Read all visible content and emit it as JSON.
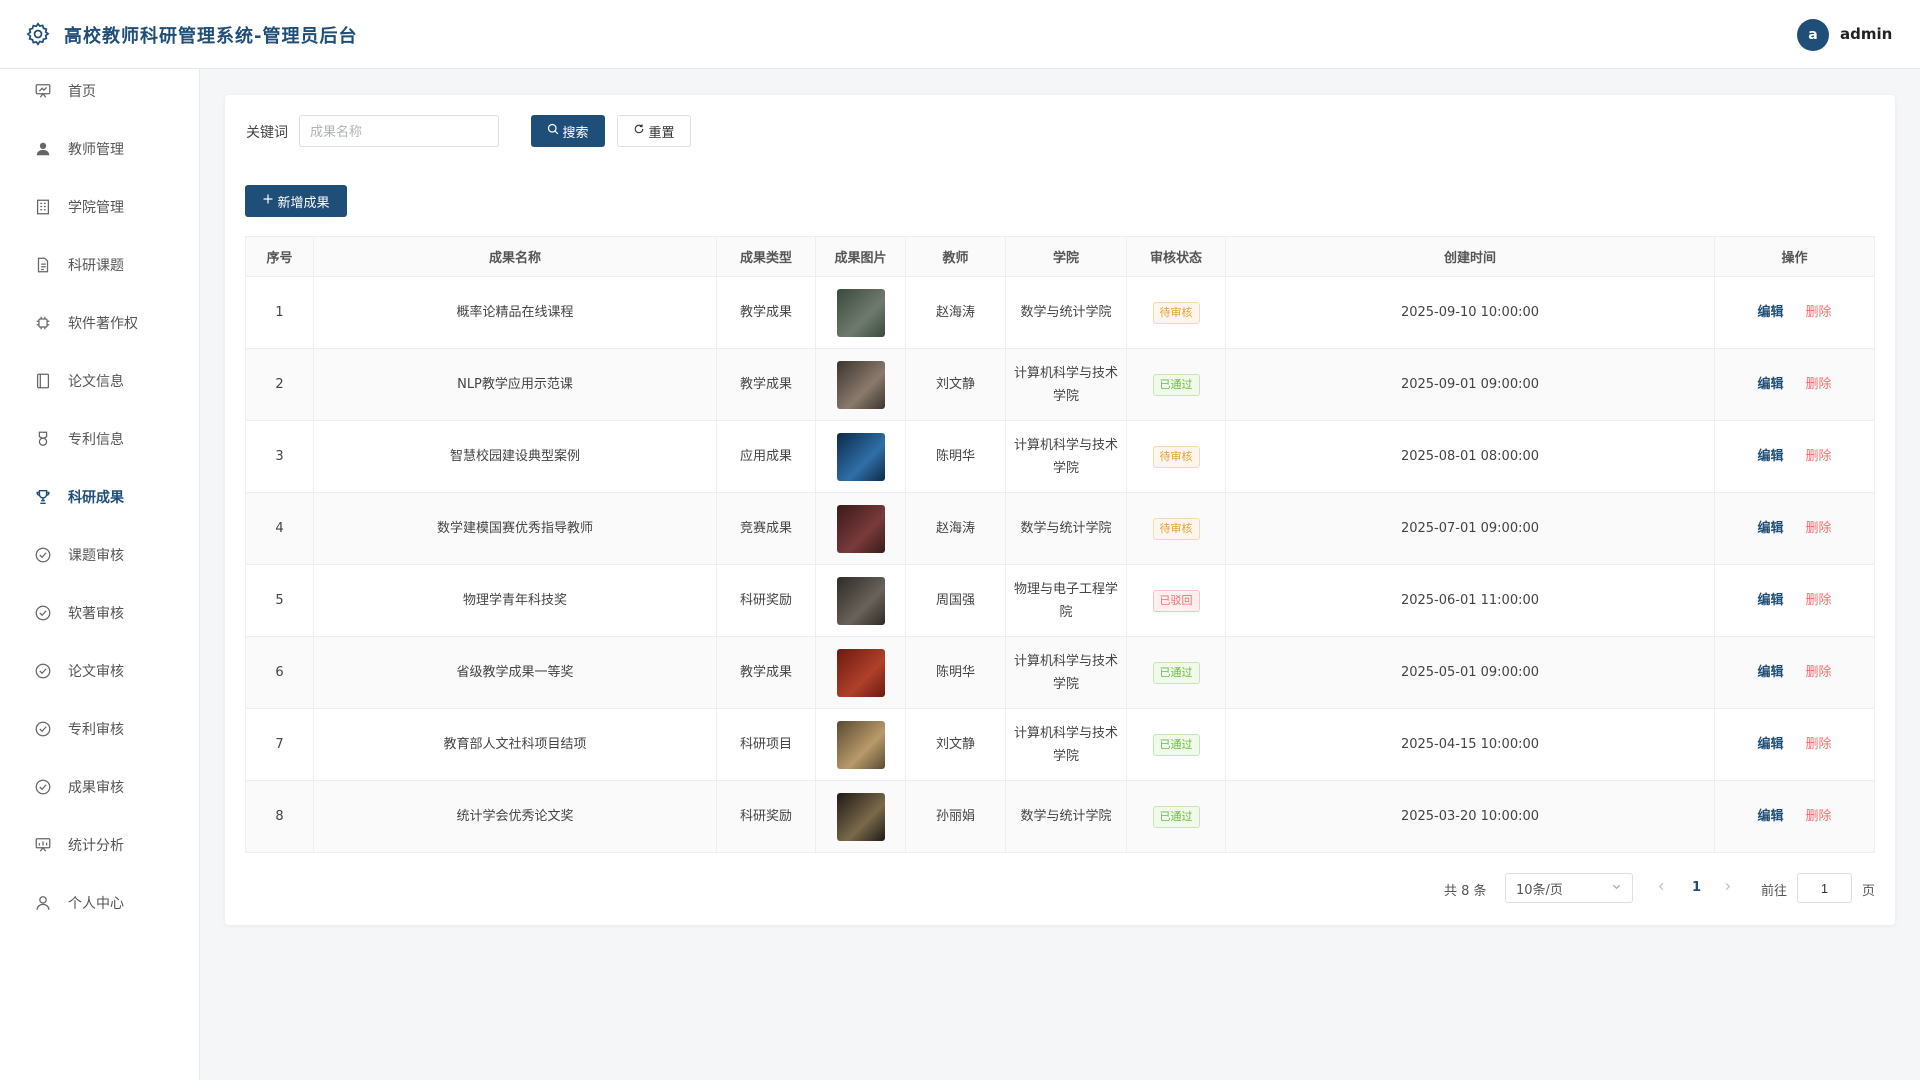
{
  "header": {
    "title": "高校教师科研管理系统-管理员后台",
    "avatar_letter": "a",
    "username": "admin"
  },
  "sidebar": {
    "items": [
      {
        "label": "首页",
        "icon": "dashboard-icon",
        "active": false
      },
      {
        "label": "教师管理",
        "icon": "user-icon",
        "active": false
      },
      {
        "label": "学院管理",
        "icon": "building-icon",
        "active": false
      },
      {
        "label": "科研课题",
        "icon": "document-icon",
        "active": false
      },
      {
        "label": "软件著作权",
        "icon": "chip-icon",
        "active": false
      },
      {
        "label": "论文信息",
        "icon": "book-icon",
        "active": false
      },
      {
        "label": "专利信息",
        "icon": "medal-icon",
        "active": false
      },
      {
        "label": "科研成果",
        "icon": "trophy-icon",
        "active": true
      },
      {
        "label": "课题审核",
        "icon": "check-circle-icon",
        "active": false
      },
      {
        "label": "软著审核",
        "icon": "check-circle-icon",
        "active": false
      },
      {
        "label": "论文审核",
        "icon": "check-circle-icon",
        "active": false
      },
      {
        "label": "专利审核",
        "icon": "check-circle-icon",
        "active": false
      },
      {
        "label": "成果审核",
        "icon": "check-circle-icon",
        "active": false
      },
      {
        "label": "统计分析",
        "icon": "chart-icon",
        "active": false
      },
      {
        "label": "个人中心",
        "icon": "profile-icon",
        "active": false
      }
    ]
  },
  "search": {
    "label": "关键词",
    "placeholder": "成果名称",
    "value": "",
    "search_btn": "搜索",
    "reset_btn": "重置",
    "add_btn": "新增成果"
  },
  "table": {
    "columns": [
      "序号",
      "成果名称",
      "成果类型",
      "成果图片",
      "教师",
      "学院",
      "审核状态",
      "创建时间",
      "操作"
    ],
    "rows": [
      {
        "no": "1",
        "name": "概率论精品在线课程",
        "type": "教学成果",
        "teacher": "赵海涛",
        "college": "数学与统计学院",
        "status": "待审核",
        "status_kind": "pending",
        "created": "2025-09-10 10:00:00",
        "thumb": [
          "#3a4a3c",
          "#6f7a6e"
        ]
      },
      {
        "no": "2",
        "name": "NLP教学应用示范课",
        "type": "教学成果",
        "teacher": "刘文静",
        "college": "计算机科学与技术学院",
        "status": "已通过",
        "status_kind": "passed",
        "created": "2025-09-01 09:00:00",
        "thumb": [
          "#3b3530",
          "#8a7a6a"
        ]
      },
      {
        "no": "3",
        "name": "智慧校园建设典型案例",
        "type": "应用成果",
        "teacher": "陈明华",
        "college": "计算机科学与技术学院",
        "status": "待审核",
        "status_kind": "pending",
        "created": "2025-08-01 08:00:00",
        "thumb": [
          "#0d2a4a",
          "#2f6fa8"
        ]
      },
      {
        "no": "4",
        "name": "数学建模国赛优秀指导教师",
        "type": "竞赛成果",
        "teacher": "赵海涛",
        "college": "数学与统计学院",
        "status": "待审核",
        "status_kind": "pending",
        "created": "2025-07-01 09:00:00",
        "thumb": [
          "#3a1a1a",
          "#7a3a3a"
        ]
      },
      {
        "no": "5",
        "name": "物理学青年科技奖",
        "type": "科研奖励",
        "teacher": "周国强",
        "college": "物理与电子工程学院",
        "status": "已驳回",
        "status_kind": "rejected",
        "created": "2025-06-01 11:00:00",
        "thumb": [
          "#2e2a26",
          "#6a625a"
        ]
      },
      {
        "no": "6",
        "name": "省级教学成果一等奖",
        "type": "教学成果",
        "teacher": "陈明华",
        "college": "计算机科学与技术学院",
        "status": "已通过",
        "status_kind": "passed",
        "created": "2025-05-01 09:00:00",
        "thumb": [
          "#6a1a12",
          "#b0402a"
        ]
      },
      {
        "no": "7",
        "name": "教育部人文社科项目结项",
        "type": "科研项目",
        "teacher": "刘文静",
        "college": "计算机科学与技术学院",
        "status": "已通过",
        "status_kind": "passed",
        "created": "2025-04-15 10:00:00",
        "thumb": [
          "#5a4a32",
          "#b89a6a"
        ]
      },
      {
        "no": "8",
        "name": "统计学会优秀论文奖",
        "type": "科研奖励",
        "teacher": "孙丽娟",
        "college": "数学与统计学院",
        "status": "已通过",
        "status_kind": "passed",
        "created": "2025-03-20 10:00:00",
        "thumb": [
          "#1e1a16",
          "#7a6a4a"
        ]
      }
    ],
    "edit_label": "编辑",
    "delete_label": "删除"
  },
  "pagination": {
    "total_text": "共 8 条",
    "page_size": "10条/页",
    "current_page": "1",
    "goto_label": "前往",
    "goto_value": "1",
    "page_suffix": "页"
  },
  "colors": {
    "primary": "#1f4e79",
    "pending": "#e6a23c",
    "passed": "#67c23a",
    "rejected": "#f56c6c"
  }
}
